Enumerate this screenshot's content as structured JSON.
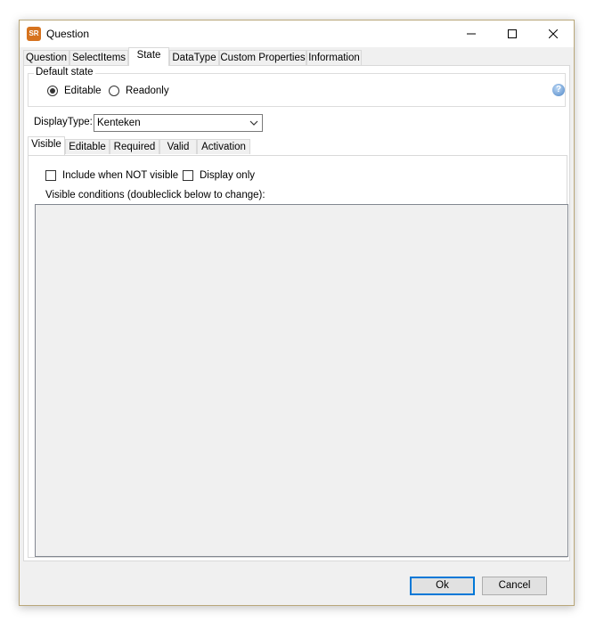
{
  "window": {
    "title": "Question",
    "app_icon_text": "SR"
  },
  "tabs": [
    {
      "label": "Question"
    },
    {
      "label": "SelectItems"
    },
    {
      "label": "State"
    },
    {
      "label": "DataType"
    },
    {
      "label": "Custom Properties"
    },
    {
      "label": "Information"
    }
  ],
  "active_tab": "State",
  "default_state": {
    "legend": "Default state",
    "options": [
      {
        "label": "Editable",
        "selected": true
      },
      {
        "label": "Readonly",
        "selected": false
      }
    ]
  },
  "display_type": {
    "label": "DisplayType:",
    "value": "Kenteken"
  },
  "subtabs": [
    {
      "label": "Visible"
    },
    {
      "label": "Editable"
    },
    {
      "label": "Required"
    },
    {
      "label": "Valid"
    },
    {
      "label": "Activation"
    }
  ],
  "active_subtab": "Visible",
  "visible": {
    "include_when_not_visible": {
      "label": "Include when NOT visible",
      "checked": false
    },
    "display_only": {
      "label": "Display only",
      "checked": false
    },
    "conditions_label": "Visible conditions (doubleclick below to change):"
  },
  "buttons": {
    "ok": "Ok",
    "cancel": "Cancel"
  },
  "colors": {
    "accent": "#0078d7",
    "icon_orange": "#d6731f"
  }
}
